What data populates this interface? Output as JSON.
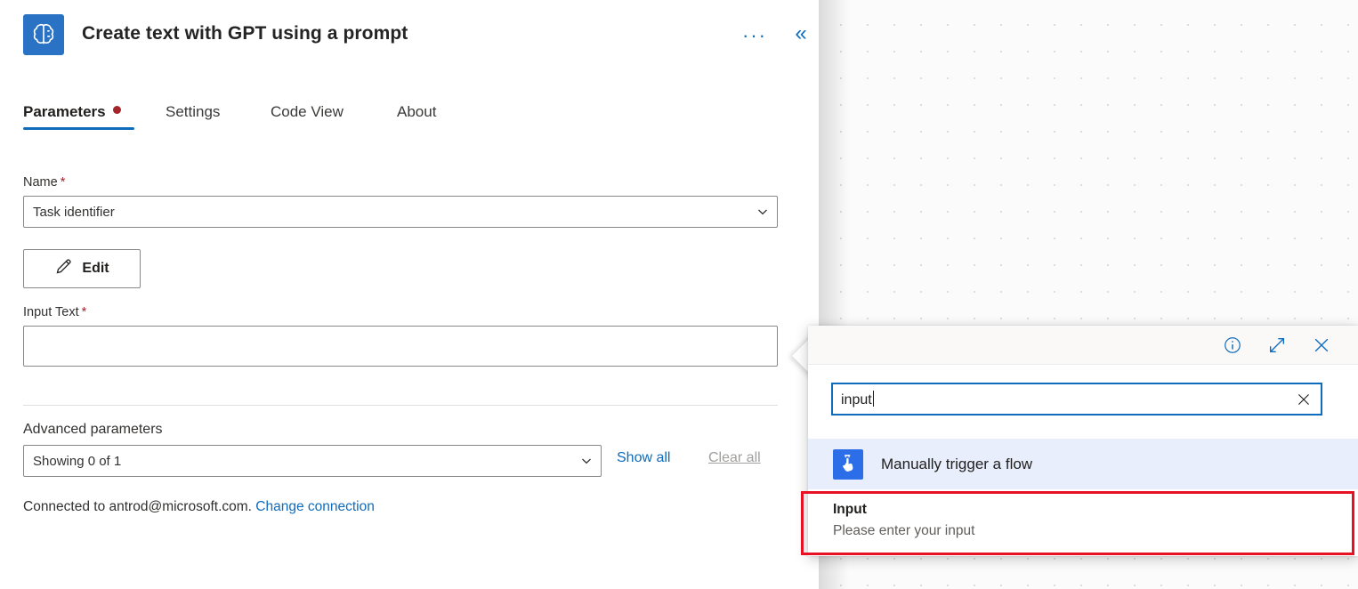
{
  "canvas": {
    "name": "flow-designer-canvas"
  },
  "panel": {
    "app_icon": "brain-icon",
    "title": "Create text with GPT using a prompt",
    "more_label": "···",
    "collapse_label": "«",
    "tabs": [
      {
        "label": "Parameters",
        "active": true,
        "has_dot": true
      },
      {
        "label": "Settings",
        "active": false,
        "has_dot": false
      },
      {
        "label": "Code View",
        "active": false,
        "has_dot": false
      },
      {
        "label": "About",
        "active": false,
        "has_dot": false
      }
    ],
    "name_field": {
      "label": "Name",
      "required_mark": "*",
      "value": "Task identifier",
      "chevron": "chevron-down-icon"
    },
    "edit_button": {
      "label": "Edit",
      "icon": "pencil-icon"
    },
    "input_text_field": {
      "label": "Input Text",
      "required_mark": "*",
      "value": ""
    },
    "advanced": {
      "label": "Advanced parameters",
      "value": "Showing 0 of 1",
      "show_all_label": "Show all",
      "clear_all_label": "Clear all"
    },
    "connection": {
      "text": "Connected to antrod@microsoft.com.",
      "change_link": "Change connection"
    }
  },
  "popup": {
    "header_icons": {
      "info": "info-circle-icon",
      "expand": "expand-diagonal-icon",
      "close": "close-icon"
    },
    "search": {
      "value": "input",
      "placeholder": "Search",
      "clear_icon": "clear-x-icon"
    },
    "results": [
      {
        "icon": "tap-hand-icon",
        "title": "Manually trigger a flow",
        "subtitle": "",
        "selected": true
      },
      {
        "icon": "",
        "title": "Input",
        "subtitle": "Please enter your input",
        "selected": false
      }
    ]
  },
  "annotation": {
    "highlight": "red-box-around-input-result"
  },
  "colors": {
    "accent_blue": "#0f6cbd",
    "icon_blue": "#2a72c4",
    "required_red": "#a4262c",
    "highlight_red": "#e81123",
    "selected_row_bg": "#e8eefc"
  }
}
